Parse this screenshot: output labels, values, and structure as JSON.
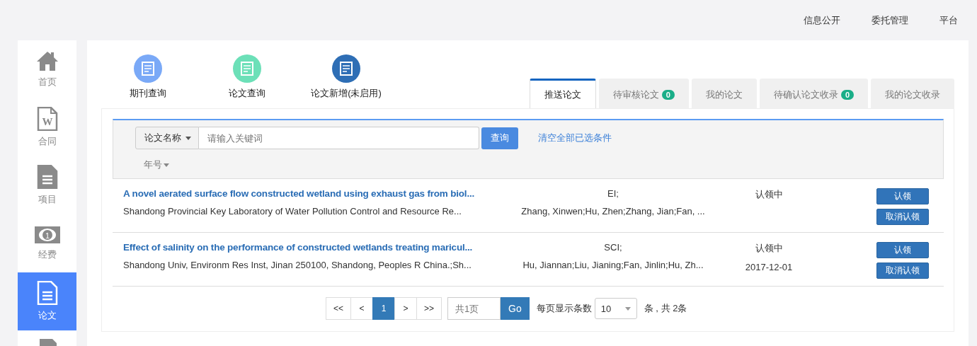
{
  "top_links": [
    "信息公开",
    "委托管理",
    "平台"
  ],
  "sidebar": {
    "items": [
      {
        "label": "首页",
        "selected": false
      },
      {
        "label": "合同",
        "icon_text": "W",
        "selected": false
      },
      {
        "label": "项目",
        "selected": false
      },
      {
        "label": "经费",
        "icon_text": "1",
        "selected": false
      },
      {
        "label": "论文",
        "selected": true
      },
      {
        "selected": false
      }
    ]
  },
  "shortcuts": [
    {
      "label": "期刊查询",
      "color": "#7aa9f7"
    },
    {
      "label": "论文查询",
      "color": "#6ce0b8"
    },
    {
      "label": "论文新增(未启用)",
      "color": "#2e6eb5"
    }
  ],
  "tabs": [
    {
      "label": "推送论文",
      "selected": true
    },
    {
      "label": "待审核论文",
      "badge": "0",
      "selected": false
    },
    {
      "label": "我的论文",
      "selected": false
    },
    {
      "label": "待确认论文收录",
      "badge": "0",
      "selected": false
    },
    {
      "label": "我的论文收录",
      "selected": false
    }
  ],
  "filter": {
    "field_select": "论文名称",
    "search": {
      "placeholder": "请输入关键词"
    },
    "search_button": "查询",
    "clear_link": "清空全部已选条件",
    "year_filter": "年号"
  },
  "rows": [
    {
      "title": "A novel aerated surface flow constructed wetland using exhaust gas from biol...",
      "affiliation": "Shandong Provincial Key Laboratory of Water Pollution Control and Resource Re...",
      "index": "EI;",
      "authors": "Zhang, Xinwen;Hu, Zhen;Zhang, Jian;Fan, ...",
      "status": "认领中",
      "buttons": [
        "认领",
        "取消认领"
      ]
    },
    {
      "title": "Effect of salinity on the performance of constructed wetlands treating maricul...",
      "affiliation": "Shandong Univ, Environm Res Inst, Jinan 250100, Shandong, Peoples R China.;Sh...",
      "index": "SCI;",
      "authors": "Hu, Jiannan;Liu, Jianing;Fan, Jinlin;Hu, Zh...",
      "status": "认领中",
      "date": "2017-12-01",
      "buttons": [
        "认领",
        "取消认领"
      ]
    }
  ],
  "pagination": {
    "pages": [
      {
        "label": "<<",
        "selected": false
      },
      {
        "label": "<",
        "selected": false
      },
      {
        "label": "1",
        "selected": true
      },
      {
        "label": ">",
        "selected": false
      },
      {
        "label": ">>",
        "selected": false
      }
    ],
    "page_input": {
      "placeholder": "共1页"
    },
    "go_button": "Go",
    "page_size_label": "每页显示条数",
    "page_size": "10",
    "total": "条 , 共 2条"
  }
}
